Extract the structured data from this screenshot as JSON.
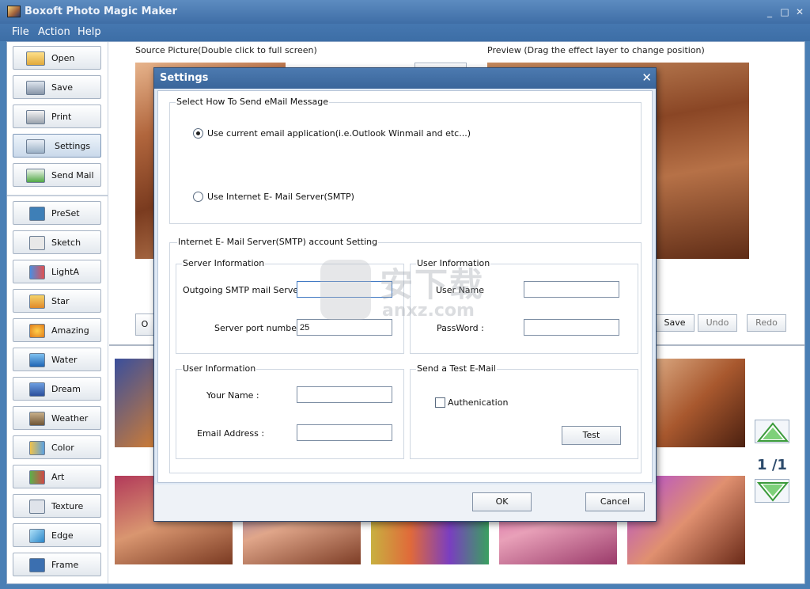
{
  "window": {
    "title": "Boxoft Photo Magic Maker",
    "minimize": "_",
    "maximize": "□",
    "close": "✕"
  },
  "menu": [
    "File",
    "Action",
    "Help"
  ],
  "sidebar": {
    "top_buttons": [
      {
        "label": "Open",
        "icon": "folder-icon"
      },
      {
        "label": "Save",
        "icon": "save-icon"
      },
      {
        "label": "Print",
        "icon": "printer-icon"
      },
      {
        "label": "Settings",
        "icon": "settings-icon"
      },
      {
        "label": "Send Mail",
        "icon": "mail-icon"
      }
    ],
    "effect_buttons": [
      {
        "label": "PreSet",
        "icon": "preset-icon"
      },
      {
        "label": "Sketch",
        "icon": "sketch-icon"
      },
      {
        "label": "LightA",
        "icon": "light-icon"
      },
      {
        "label": "Star",
        "icon": "star-icon"
      },
      {
        "label": "Amazing",
        "icon": "amazing-icon"
      },
      {
        "label": "Water",
        "icon": "water-icon"
      },
      {
        "label": "Dream",
        "icon": "dream-icon"
      },
      {
        "label": "Weather",
        "icon": "weather-icon"
      },
      {
        "label": "Color",
        "icon": "color-icon"
      },
      {
        "label": "Art",
        "icon": "art-icon"
      },
      {
        "label": "Texture",
        "icon": "texture-icon"
      },
      {
        "label": "Edge",
        "icon": "edge-icon"
      },
      {
        "label": "Frame",
        "icon": "frame-icon"
      }
    ]
  },
  "work": {
    "source_caption": "Source Picture(Double click to full screen)",
    "preview_caption": "Preview (Drag the effect layer to change position)",
    "open_partial": "O",
    "save_label": "Save",
    "undo_label": "Undo",
    "redo_label": "Redo",
    "pager": "1 /1"
  },
  "dialog": {
    "title": "Settings",
    "close": "✕",
    "send_group": {
      "legend": "Select How To Send eMail Message",
      "option_current": "Use current email application(i.e.Outlook Winmail and etc...)",
      "option_smtp": "Use Internet E- Mail Server(SMTP)",
      "selected": "current"
    },
    "smtp_group": {
      "legend": "Internet E- Mail Server(SMTP) account Setting",
      "server_info": {
        "legend": "Server Information",
        "smtp_label": "Outgoing SMTP mail Server:",
        "smtp_value": "",
        "port_label": "Server port number :",
        "port_value": "25"
      },
      "user_info_right": {
        "legend": "User Information",
        "username_label": "User Name",
        "username_value": "",
        "password_label": "PassWord :",
        "password_value": ""
      },
      "user_info_left": {
        "legend": "User Information",
        "name_label": "Your Name :",
        "name_value": "",
        "email_label": "Email Address :",
        "email_value": ""
      },
      "test_group": {
        "legend": "Send a Test E-Mail",
        "auth_label": "Authenication",
        "auth_checked": false,
        "test_button": "Test"
      }
    },
    "ok": "OK",
    "cancel": "Cancel"
  },
  "watermark": {
    "cn": "安下载",
    "url": "anxz.com"
  },
  "colors": {
    "titlebar": "#3f6ea6",
    "dialog_bg": "#dfe9f5",
    "accent": "#2c4a6b"
  }
}
